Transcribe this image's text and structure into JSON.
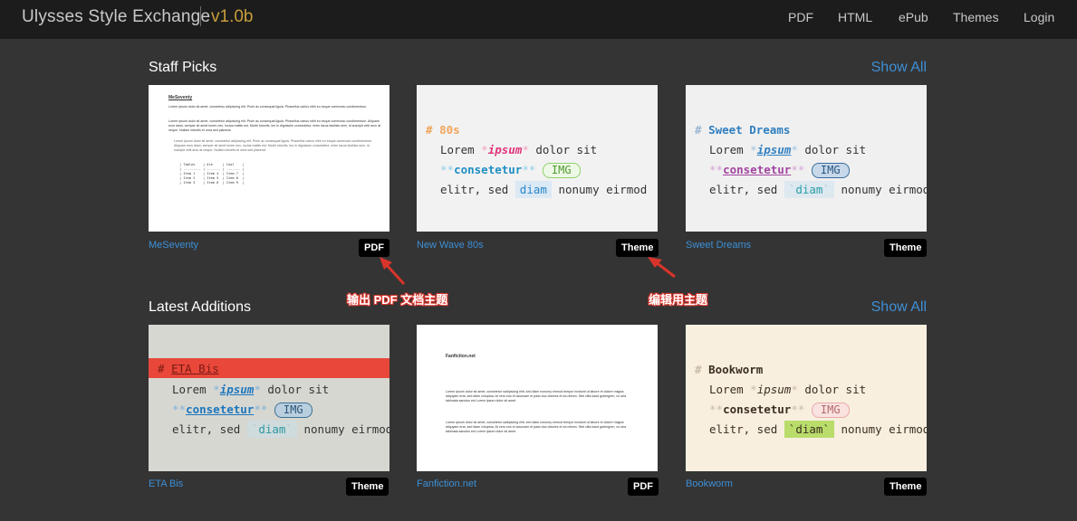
{
  "header": {
    "brand": "Ulysses Style Exchange",
    "version": "v1.0b",
    "nav": [
      "PDF",
      "HTML",
      "ePub",
      "Themes",
      "Login"
    ]
  },
  "sections": [
    {
      "title": "Staff Picks",
      "show_all": "Show All",
      "cards": [
        {
          "name": "MeSeventy",
          "badge": "PDF"
        },
        {
          "name": "New Wave 80s",
          "badge": "Theme"
        },
        {
          "name": "Sweet Dreams",
          "badge": "Theme"
        }
      ]
    },
    {
      "title": "Latest Additions",
      "show_all": "Show All",
      "cards": [
        {
          "name": "ETA Bis",
          "badge": "Theme"
        },
        {
          "name": "Fanfiction.net",
          "badge": "PDF"
        },
        {
          "name": "Bookworm",
          "badge": "Theme"
        }
      ]
    }
  ],
  "annotations": {
    "pdf_note": "输出 PDF 文档主题",
    "theme_note": "编辑用主题"
  },
  "previews": {
    "meseventy": {
      "title": "MeSeventy",
      "para1": "Lorem ipsum dolor sit amet, consetetur adipiscing elit. Proin ac consequat ligula. Phasellus varius nibh eu esque commodo condimentum.",
      "para2": "Lorem ipsum dolor sit amet, consetetur adipiscing elit. Proin ac consequat ligula. Phasellus varius nibh eu esque commodo condimentum. Aliquam eros diam, semper sit amet lorem nec, luctus mattis est. Morbi lobortis, leo in dignissim consectetur, enim lacus facilisis sem, id suscipit velit arcu at neque. Nullam lobortis et urna sed placerat.",
      "para3": "Lorem ipsum dolor sit amet, consetetur adipiscing elit. Proin ac consequat ligula. Phasellus varius nibh eu esque commodo condimentum. Aliquam eros diam, semper sit amet lorem nec, luctus mattis est. Morbi lobortis, leo in dignissim consectetur, enim lacus facilisis sem, id suscipit velit arcu at neque. Nullam lobortis et urna sed placerat.",
      "table": "| Tables    | Are     | Cool    |\n| --------- | ------- | ------- |\n| Item 1    | Item 4  | Item 7  |\n| Item 2    | Item 5  | Item 8  |\n| Item 3    | Item 6  | Item 9  |"
    },
    "theme_sample": {
      "heading_80s": "80s",
      "heading_sweet": "Sweet Dreams",
      "heading_eta": "ETA Bis",
      "heading_book": "Bookworm",
      "hash": "#",
      "lorem": "Lorem",
      "ipsum": "ipsum",
      "dolor": "dolor sit",
      "consetetur": "consetetur",
      "img": "IMG",
      "elitr": "elitr, sed",
      "diam": "diam",
      "nonumy": "nonumy eirmod",
      "star": "*",
      "stars": "**",
      "tick": "`"
    },
    "fanfiction": {
      "title": "Fanfiction.net",
      "para1": "Lorem ipsum dolor sit amet, consetetur sadipscing elitr, sed diam nonumy eirmod tempor invidunt ut labore et dolore magna aliquyam erat, sed diam voluptua. At vero eos et accusam et justo duo dolores et ea rebum. Stet clita kasd gubergren, no sea takimata sanctus est Lorem ipsum dolor sit amet.",
      "para2": "Lorem ipsum dolor sit amet, consetetur sadipscing elitr, sed diam nonumy eirmod tempor invidunt ut labore et dolore magna aliquyam erat, sed diam voluptua. At vero eos et accusam et justo duo dolores et ea rebum. Stet clita kasd gubergren, no sea takimata sanctus est Lorem ipsum dolor sit amet."
    }
  },
  "colors": {
    "link": "#3d8fd6",
    "version": "#c99d3a",
    "annotation": "#d9342b"
  }
}
